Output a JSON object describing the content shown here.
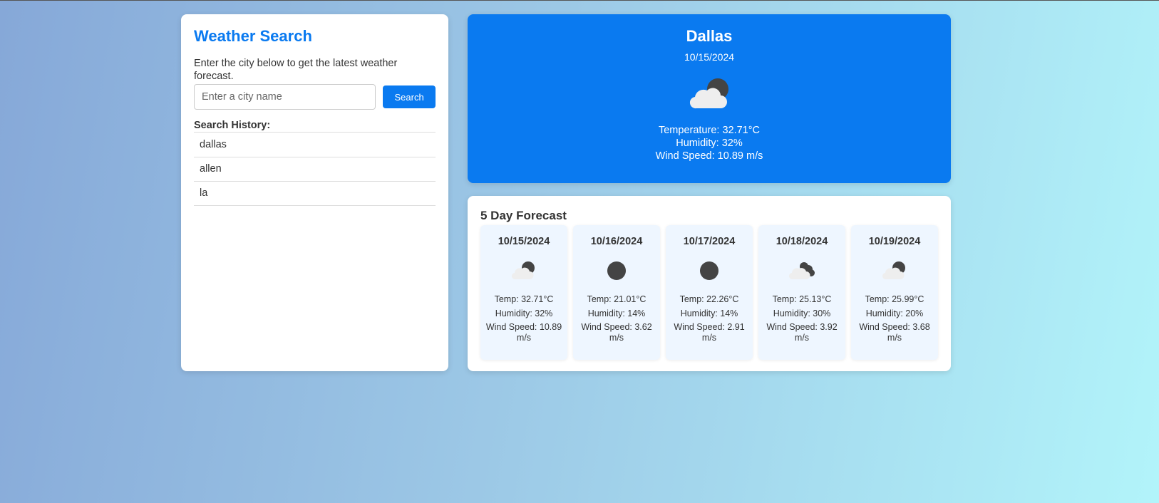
{
  "search": {
    "title": "Weather Search",
    "description": "Enter the city below to get the latest weather forecast.",
    "placeholder": "Enter a city name",
    "value": "",
    "button_label": "Search",
    "history_title": "Search History:",
    "history": [
      "dallas",
      "allen",
      "la"
    ]
  },
  "current": {
    "city": "Dallas",
    "date": "10/15/2024",
    "icon": "partly-cloudy-night-icon",
    "temperature": "Temperature: 32.71°C",
    "humidity": "Humidity: 32%",
    "wind": "Wind Speed: 10.89 m/s"
  },
  "forecast": {
    "title": "5 Day Forecast",
    "days": [
      {
        "date": "10/15/2024",
        "icon": "partly-cloudy-night-icon",
        "temp": "Temp: 32.71°C",
        "humidity": "Humidity: 32%",
        "wind": "Wind Speed: 10.89 m/s"
      },
      {
        "date": "10/16/2024",
        "icon": "clear-night-icon",
        "temp": "Temp: 21.01°C",
        "humidity": "Humidity: 14%",
        "wind": "Wind Speed: 3.62 m/s"
      },
      {
        "date": "10/17/2024",
        "icon": "clear-night-icon",
        "temp": "Temp: 22.26°C",
        "humidity": "Humidity: 14%",
        "wind": "Wind Speed: 2.91 m/s"
      },
      {
        "date": "10/18/2024",
        "icon": "scattered-clouds-icon",
        "temp": "Temp: 25.13°C",
        "humidity": "Humidity: 30%",
        "wind": "Wind Speed: 3.92 m/s"
      },
      {
        "date": "10/19/2024",
        "icon": "partly-cloudy-night-icon",
        "temp": "Temp: 25.99°C",
        "humidity": "Humidity: 20%",
        "wind": "Wind Speed: 3.68 m/s"
      }
    ]
  },
  "colors": {
    "accent": "#0a7af0",
    "card_bg": "#eef6ff",
    "moon": "#444444",
    "cloud": "#eeeeee"
  }
}
